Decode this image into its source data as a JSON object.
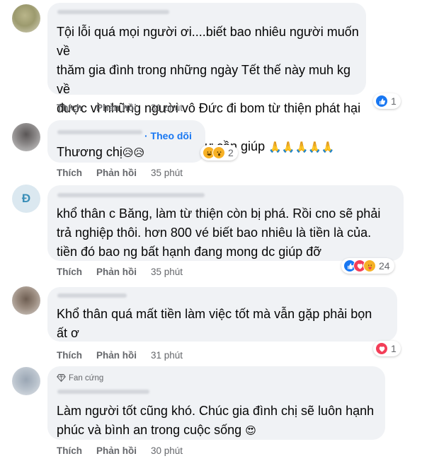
{
  "action_labels": {
    "like": "Thích",
    "reply": "Phản hồi"
  },
  "comments": [
    {
      "text_lines": [
        "Tội lỗi quá mọi người ơi....biết bao nhiêu người muốn về",
        "thăm gia đình trong những ngày Tết thế này muh kg về",
        "được vì những người vô Đức đi bom từ thiện phát hại hy",
        "vọng của người học thật sự cần giúp"
      ],
      "trailing_emoji": "🙏🙏🙏🙏🙏",
      "time": "31 phút",
      "reactions": [
        "like-icon"
      ],
      "reaction_count": "1"
    },
    {
      "follow_label": "· Theo dõi",
      "text": "Thương chị",
      "trailing_emoji": "😥😥",
      "time": "35 phút",
      "reactions": [
        "haha-icon",
        "wow-icon"
      ],
      "reaction_count": "2"
    },
    {
      "avatar_letter": "Đ",
      "text_lines": [
        "khổ thân c Băng, làm từ thiện còn bị phá. Rồi cno sẽ phải",
        "trả nghiệp thôi. hơn 800 vé biết bao nhiêu là tiền là của.",
        "tiền đó bao ng bất hạnh đang mong dc giúp đỡ"
      ],
      "time": "35 phút",
      "reactions": [
        "like-icon",
        "heart-icon",
        "care-icon"
      ],
      "reaction_count": "24"
    },
    {
      "text_lines": [
        "Khổ thân quá mất tiền làm việc tốt mà vẫn gặp phải bọn",
        "ất ơ"
      ],
      "time": "31 phút",
      "reactions": [
        "heart-icon"
      ],
      "reaction_count": "1"
    },
    {
      "badge": "Fan cứng",
      "text_lines": [
        "Làm người tốt cũng khó. Chúc gia đình chị sẽ luôn hạnh",
        "phúc và bình an trong cuộc sống"
      ],
      "trailing_emoji": "😍",
      "time": "30 phút"
    }
  ]
}
